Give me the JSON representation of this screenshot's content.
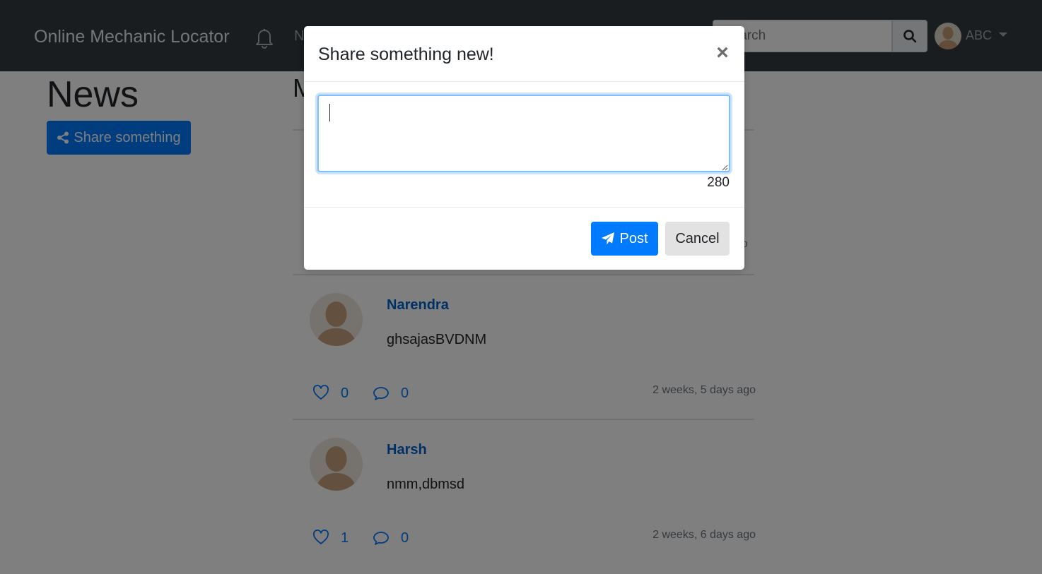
{
  "navbar": {
    "brand": "Online Mechanic Locator",
    "nav_link": "N",
    "search_placeholder": "Search",
    "user_name": "ABC"
  },
  "sidebar": {
    "title": "News",
    "share_button_label": "Share something"
  },
  "feed": {
    "heading": "M",
    "first_post_time_fragment": "go",
    "posts": [
      {
        "author": "Narendra",
        "content": "ghsajasBVDNM",
        "likes": "0",
        "comments": "0",
        "time": "2 weeks, 5 days ago"
      },
      {
        "author": "Harsh",
        "content": "nmm,dbmsd",
        "likes": "1",
        "comments": "0",
        "time": "2 weeks, 6 days ago"
      }
    ]
  },
  "modal": {
    "title": "Share something new!",
    "close_symbol": "×",
    "textarea_value": "",
    "char_count": "280",
    "post_label": "Post",
    "cancel_label": "Cancel"
  },
  "colors": {
    "navbar_bg": "#343a40",
    "primary": "#007bff",
    "link": "#0062cc",
    "muted": "#6c757d",
    "backdrop": "rgba(0,0,0,0.5)"
  }
}
